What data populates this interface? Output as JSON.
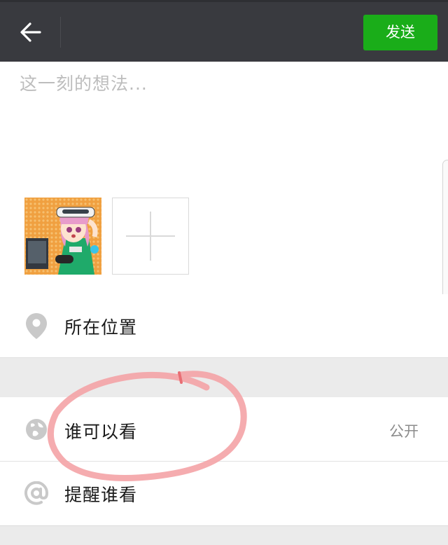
{
  "header": {
    "back_icon": "arrow-left-icon",
    "send_label": "发送",
    "send_color": "#1aad19",
    "bar_color": "#393a3f"
  },
  "composer": {
    "placeholder": "这一刻的想法..."
  },
  "photos": {
    "add_icon": "plus-icon"
  },
  "options": {
    "location": {
      "icon": "location-pin-icon",
      "label": "所在位置"
    },
    "visibility": {
      "icon": "globe-icon",
      "label": "谁可以看",
      "value": "公开"
    },
    "mention": {
      "icon": "at-sign-icon",
      "label": "提醒谁看"
    }
  },
  "annotation": {
    "color": "#f4a3a6",
    "shape": "hand-drawn-circle"
  }
}
